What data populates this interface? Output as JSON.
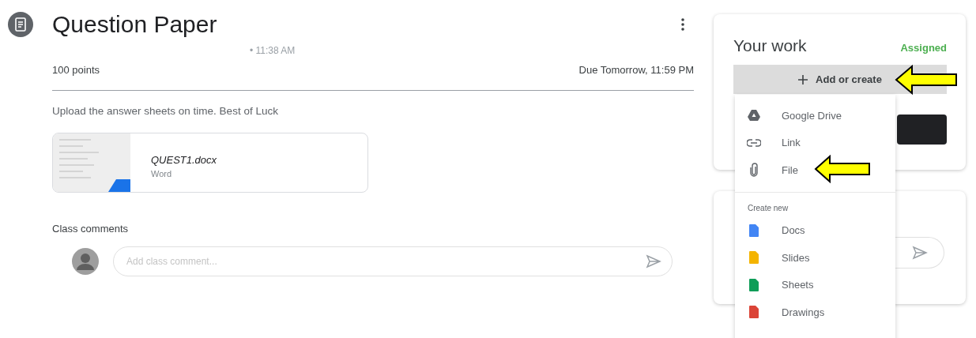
{
  "assignment": {
    "title": "Question Paper",
    "time": "• 11:38 AM",
    "points": "100 points",
    "due": "Due Tomorrow, 11:59 PM",
    "instructions": "Upload the answer sheets on time.  Best of Luck"
  },
  "attachment": {
    "name": "QUEST1.docx",
    "type": "Word"
  },
  "class_comments": {
    "heading": "Class comments",
    "placeholder": "Add class comment..."
  },
  "your_work": {
    "title": "Your work",
    "status": "Assigned",
    "add_button": "Add or create"
  },
  "add_menu": {
    "items": [
      {
        "label": "Google Drive",
        "kind": "drive"
      },
      {
        "label": "Link",
        "kind": "link"
      },
      {
        "label": "File",
        "kind": "file"
      }
    ],
    "section": "Create new",
    "create_items": [
      {
        "label": "Docs",
        "color": "#4285f4"
      },
      {
        "label": "Slides",
        "color": "#f4b400"
      },
      {
        "label": "Sheets",
        "color": "#0f9d58"
      },
      {
        "label": "Drawings",
        "color": "#db4437"
      }
    ]
  }
}
